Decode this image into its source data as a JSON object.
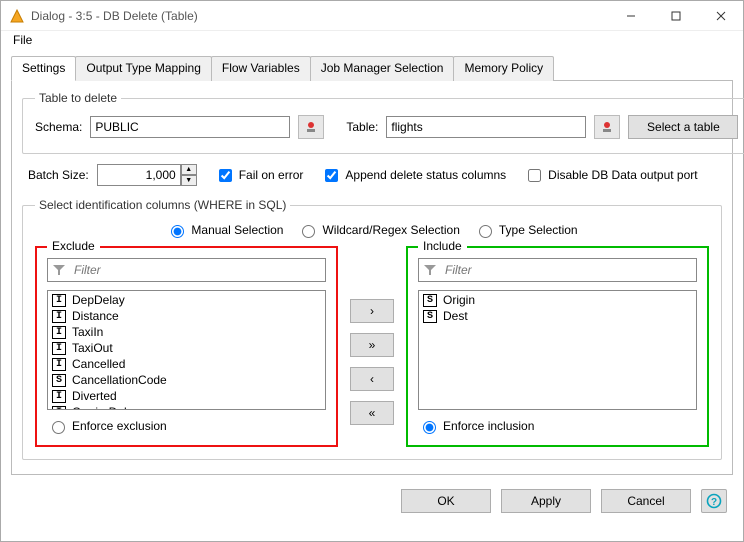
{
  "window": {
    "title": "Dialog - 3:5 - DB Delete (Table)"
  },
  "menu": {
    "file": "File"
  },
  "tabs": [
    {
      "label": "Settings",
      "active": true
    },
    {
      "label": "Output Type Mapping"
    },
    {
      "label": "Flow Variables"
    },
    {
      "label": "Job Manager Selection"
    },
    {
      "label": "Memory Policy"
    }
  ],
  "tableToDelete": {
    "legend": "Table to delete",
    "schemaLabel": "Schema:",
    "schemaValue": "PUBLIC",
    "tableLabel": "Table:",
    "tableValue": "flights",
    "selectTable": "Select a table"
  },
  "batch": {
    "label": "Batch Size:",
    "value": "1,000",
    "failOnError": {
      "label": "Fail on error",
      "checked": true
    },
    "appendStatus": {
      "label": "Append delete status columns",
      "checked": true
    },
    "disableOutput": {
      "label": "Disable DB Data output port",
      "checked": false
    }
  },
  "idCols": {
    "legend": "Select identification columns (WHERE in SQL)",
    "modes": {
      "manual": "Manual Selection",
      "wildcard": "Wildcard/Regex Selection",
      "type": "Type Selection"
    },
    "filterPlaceholder": "Filter",
    "exclude": {
      "legend": "Exclude",
      "enforce": "Enforce exclusion",
      "enforceChecked": false,
      "items": [
        {
          "type": "I",
          "name": "DepDelay"
        },
        {
          "type": "I",
          "name": "Distance"
        },
        {
          "type": "I",
          "name": "TaxiIn"
        },
        {
          "type": "I",
          "name": "TaxiOut"
        },
        {
          "type": "I",
          "name": "Cancelled"
        },
        {
          "type": "S",
          "name": "CancellationCode"
        },
        {
          "type": "I",
          "name": "Diverted"
        },
        {
          "type": "I",
          "name": "CarrierDelay"
        }
      ]
    },
    "include": {
      "legend": "Include",
      "enforce": "Enforce inclusion",
      "enforceChecked": true,
      "items": [
        {
          "type": "S",
          "name": "Origin"
        },
        {
          "type": "S",
          "name": "Dest"
        }
      ]
    }
  },
  "footer": {
    "ok": "OK",
    "apply": "Apply",
    "cancel": "Cancel"
  }
}
